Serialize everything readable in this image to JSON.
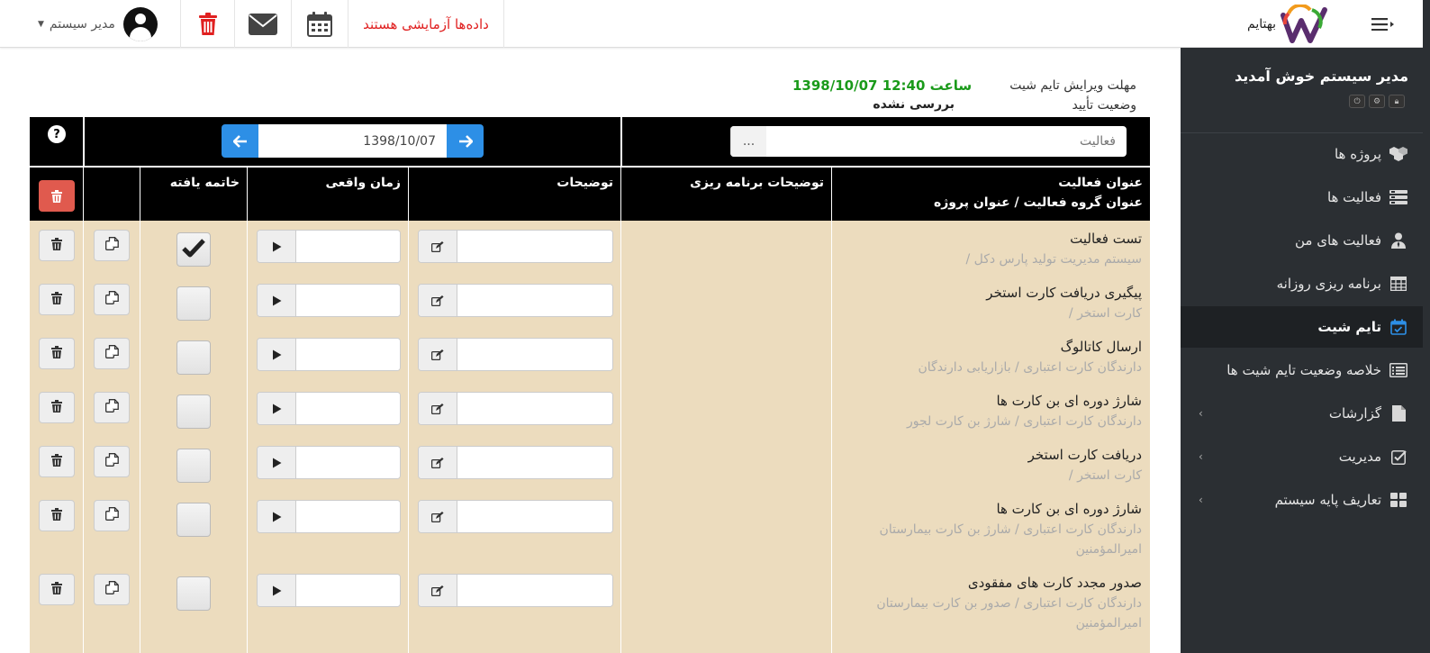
{
  "brand": {
    "name": "بهتایم"
  },
  "topbar": {
    "user_name": "مدیر سیستم",
    "demo_notice": "داده‌ها آزمایشی هستند",
    "icons": [
      "trash-icon",
      "envelope-icon",
      "calendar-icon",
      "menu-icon"
    ],
    "trash_color": "#e02020"
  },
  "sidebar": {
    "welcome": "مدیر سیستم خوش آمدید",
    "mini_icons": [
      "power-icon",
      "gear-icon",
      "lock-icon"
    ],
    "items": [
      {
        "label": "پروژه ها",
        "icon": "cubes-icon",
        "active": false,
        "has_submenu": false
      },
      {
        "label": "فعالیت ها",
        "icon": "tasks-icon",
        "active": false,
        "has_submenu": false
      },
      {
        "label": "فعالیت های من",
        "icon": "user-tie-icon",
        "active": false,
        "has_submenu": false
      },
      {
        "label": "برنامه ریزی روزانه",
        "icon": "table-icon",
        "active": false,
        "has_submenu": false
      },
      {
        "label": "تایم شیت",
        "icon": "calendar-check-icon",
        "active": true,
        "has_submenu": false
      },
      {
        "label": "خلاصه وضعیت تایم شیت ها",
        "icon": "list-alt-icon",
        "active": false,
        "has_submenu": false
      },
      {
        "label": "گزارشات",
        "icon": "file-icon",
        "active": false,
        "has_submenu": true
      },
      {
        "label": "مدیریت",
        "icon": "check-square-icon",
        "active": false,
        "has_submenu": true
      },
      {
        "label": "تعاریف پایه سیستم",
        "icon": "th-large-icon",
        "active": false,
        "has_submenu": true
      }
    ],
    "active_color": "#2d8fe6",
    "bg_color": "#2b2f33"
  },
  "info": {
    "deadline_label": "مهلت ویرایش تایم شیت",
    "deadline_value": "1398/10/07 ساعت 12:40",
    "status_label": "وضعیت تأیید",
    "status_value": "بررسی نشده"
  },
  "filters": {
    "activity_placeholder": "فعالیت",
    "activity_button": "...",
    "date_value": "1398/10/07",
    "help": "?"
  },
  "table": {
    "headers": {
      "activity_title": "عنوان فعالیت",
      "group_project": "عنوان گروه فعالیت  /  عنوان پروژه",
      "planning_notes": "توضیحات برنامه ریزی",
      "description": "توضیحات",
      "actual_time": "زمان واقعی",
      "completed": "خاتمه یافته"
    },
    "rows": [
      {
        "title": "تست فعالیت",
        "subtitle": " /  سیستم مدیریت تولید پارس دکل",
        "completed": true
      },
      {
        "title": "پیگیری دریافت کارت استخر",
        "subtitle": " /  کارت استخر",
        "completed": false
      },
      {
        "title": "ارسال کاتالوگ",
        "subtitle": "دارندگان کارت اعتباری  /  بازاریابی دارندگان",
        "completed": false
      },
      {
        "title": "شارژ دوره ای بن کارت ها",
        "subtitle": "دارندگان کارت اعتباری  /  شارژ بن کارت لجور",
        "completed": false
      },
      {
        "title": "دریافت کارت استخر",
        "subtitle": " /  کارت استخر",
        "completed": false
      },
      {
        "title": "شارژ دوره ای بن کارت ها",
        "subtitle": "دارندگان کارت اعتباری  /  شارژ بن کارت بیمارستان امیرالمؤمنین",
        "completed": false
      },
      {
        "title": "صدور مجدد کارت های مفقودی",
        "subtitle": "دارندگان کارت اعتباری  /  صدور بن کارت بیمارستان امیرالمؤمنین",
        "completed": false
      }
    ],
    "row_bg": "#ecdcbe",
    "delete_color": "#e05a4e"
  }
}
